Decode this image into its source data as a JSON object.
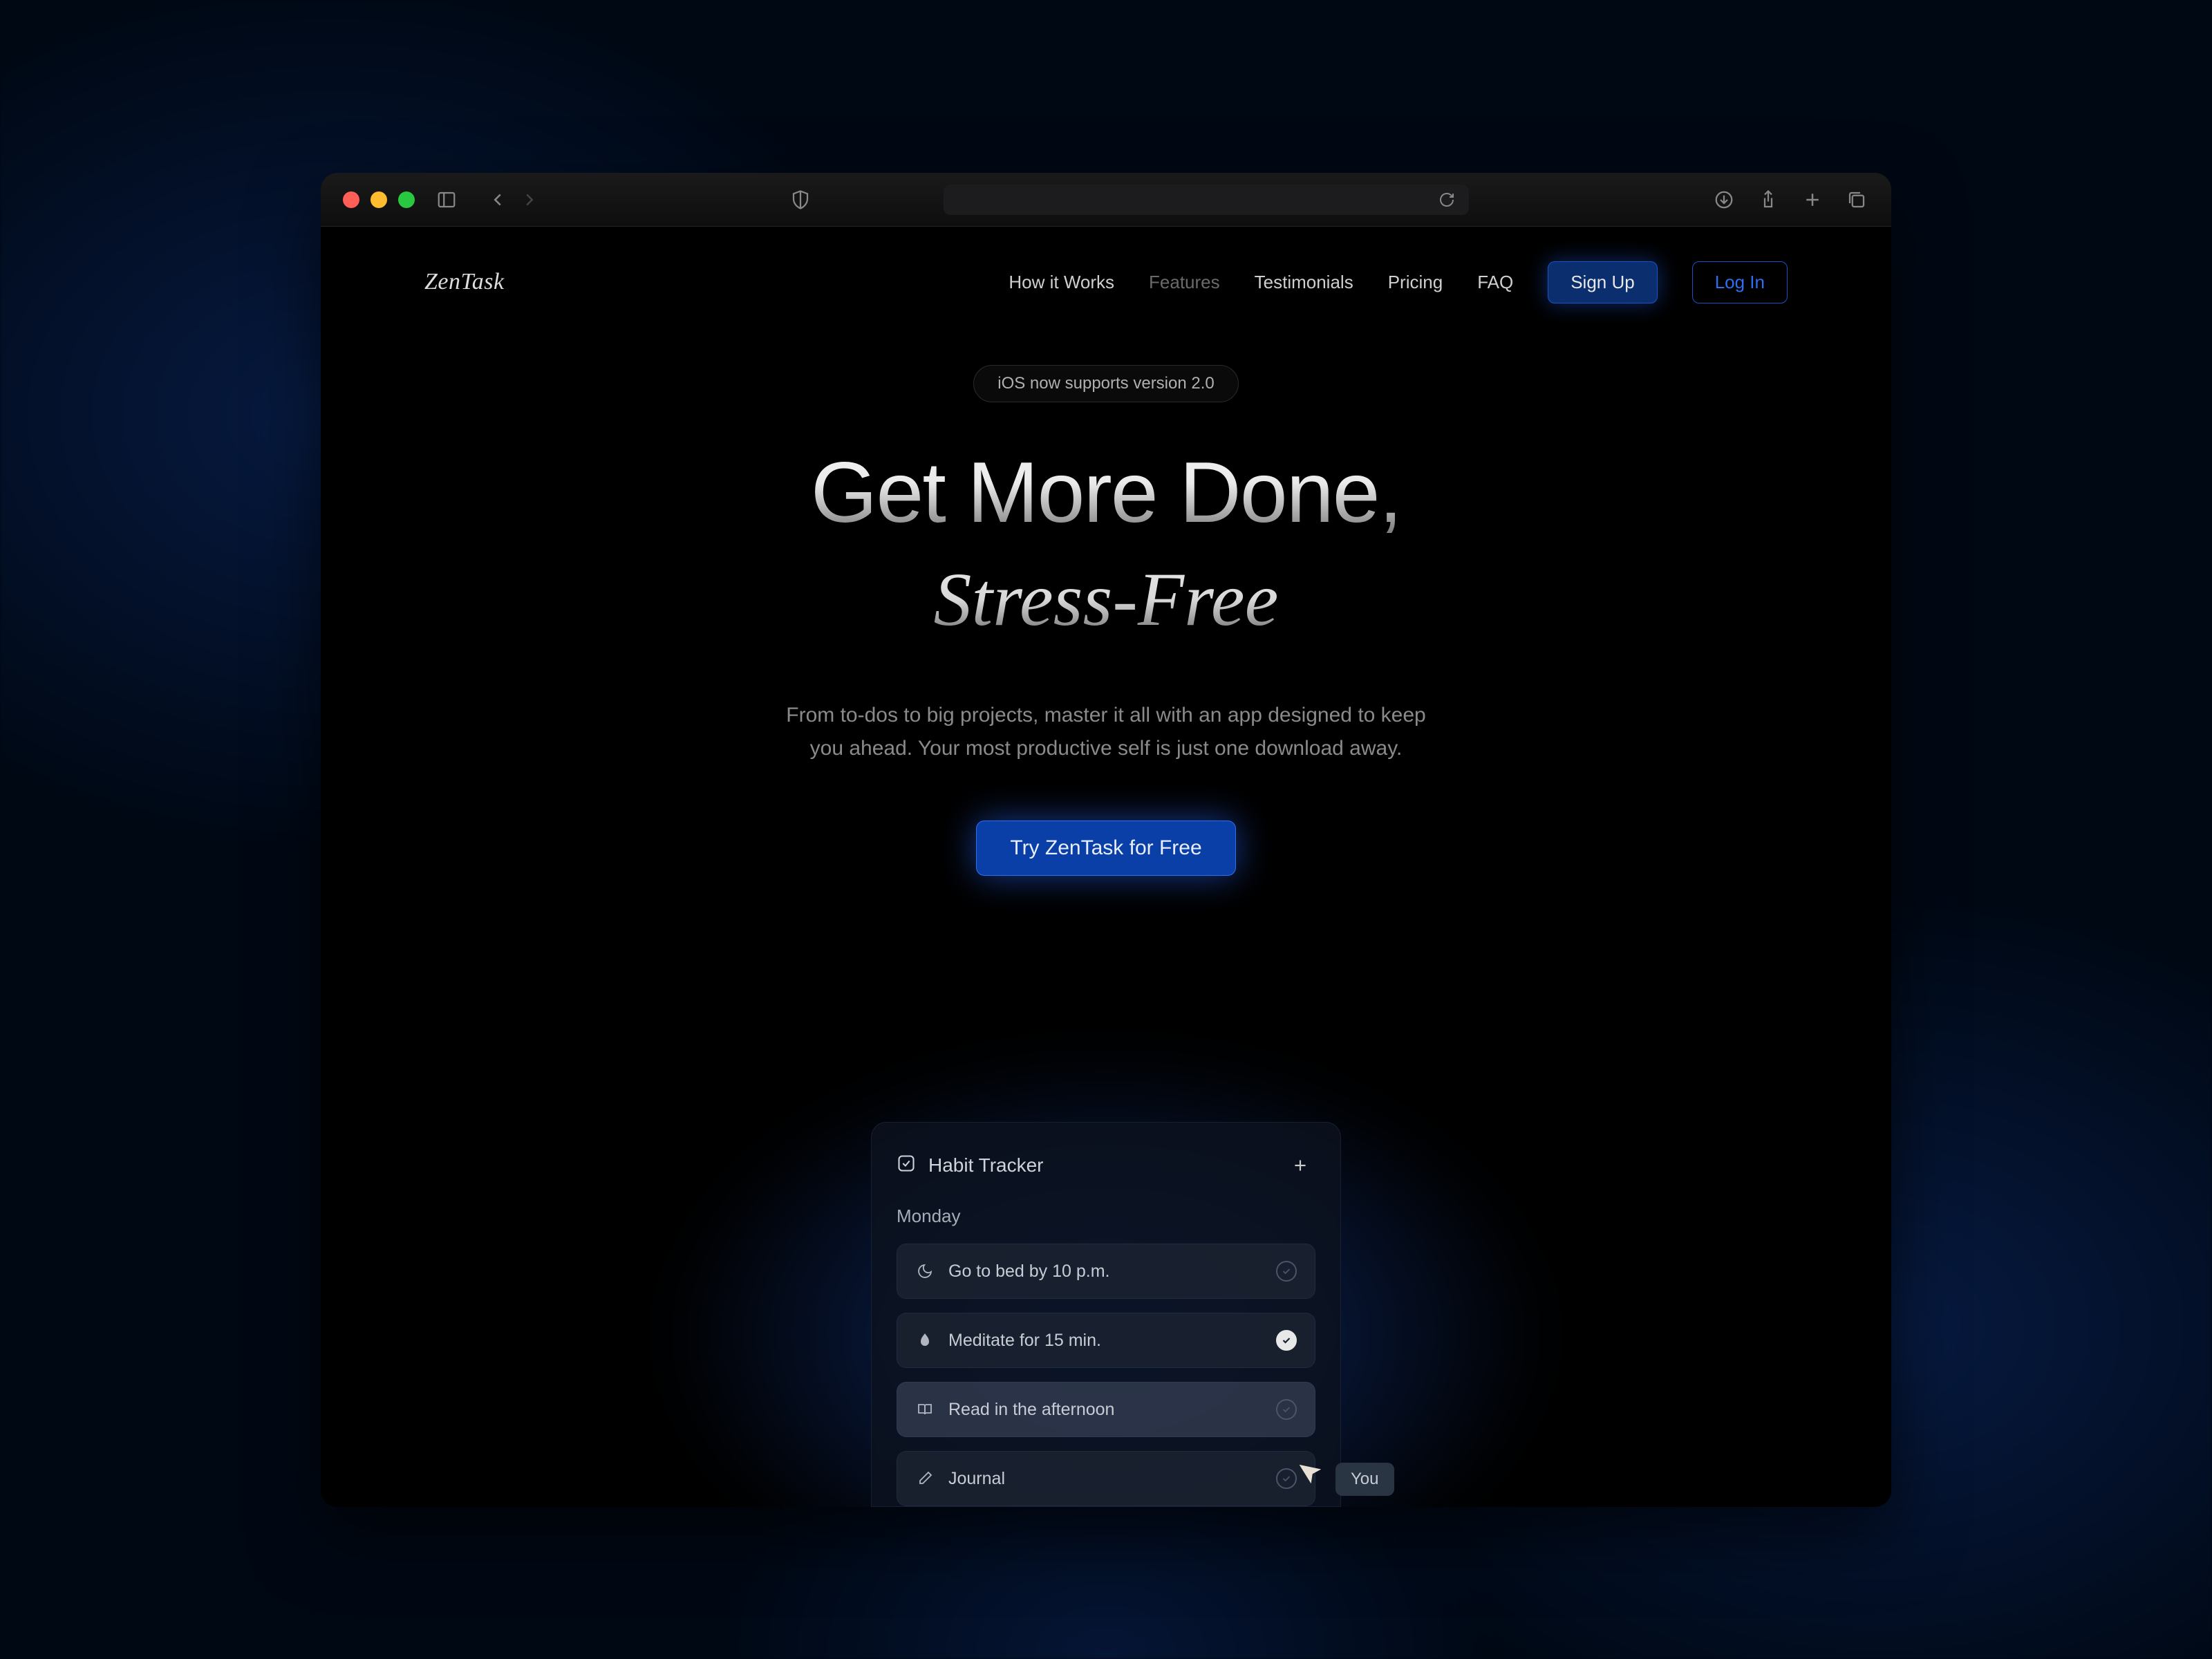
{
  "brand": "ZenTask",
  "nav": {
    "items": [
      {
        "label": "How it Works",
        "dim": false
      },
      {
        "label": "Features",
        "dim": true
      },
      {
        "label": "Testimonials",
        "dim": false
      },
      {
        "label": "Pricing",
        "dim": false
      },
      {
        "label": "FAQ",
        "dim": false
      }
    ],
    "signup": "Sign Up",
    "login": "Log In"
  },
  "hero": {
    "pill": "iOS now supports version 2.0",
    "headline_1": "Get More Done,",
    "headline_2": "Stress-Free",
    "subhead": "From to-dos to big projects, master it all with an app designed to keep you ahead. Your most productive self is just one download away.",
    "cta": "Try ZenTask for Free"
  },
  "habit_card": {
    "title": "Habit Tracker",
    "day": "Monday",
    "items": [
      {
        "label": "Go to bed by 10 p.m.",
        "done": false,
        "icon": "moon"
      },
      {
        "label": "Meditate for 15 min.",
        "done": true,
        "icon": "leaf"
      },
      {
        "label": "Read in the afternoon",
        "done": false,
        "icon": "book",
        "selected": true
      },
      {
        "label": "Journal",
        "done": false,
        "icon": "pencil"
      }
    ]
  },
  "cursor_badge": "You"
}
